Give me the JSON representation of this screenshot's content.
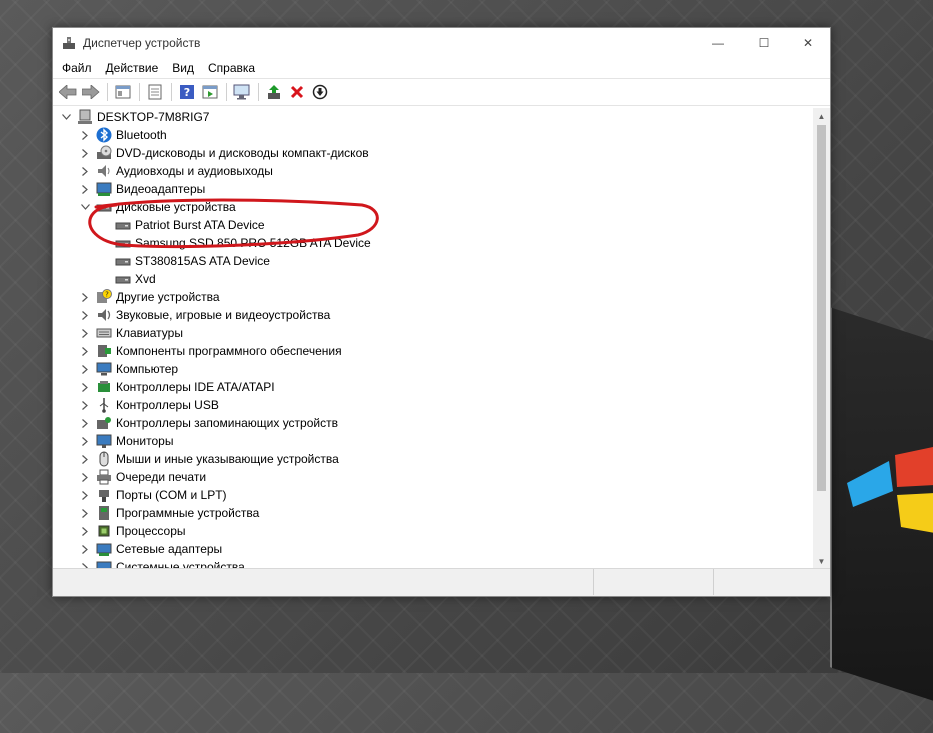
{
  "window": {
    "title": "Диспетчер устройств",
    "minimize_glyph": "—",
    "maximize_glyph": "☐",
    "close_glyph": "✕"
  },
  "menu": [
    "Файл",
    "Действие",
    "Вид",
    "Справка"
  ],
  "toolbar_icons": [
    "back-arrow-icon",
    "forward-arrow-icon",
    "properties-icon",
    "show-hidden-icon",
    "help-icon",
    "action-view-icon",
    "scan-hardware-icon",
    "update-driver-icon",
    "uninstall-icon",
    "disable-device-icon"
  ],
  "tree": {
    "root": "DESKTOP-7M8RIG7",
    "categories": [
      {
        "label": "Bluetooth",
        "icon": "bluetooth-icon",
        "expanded": false
      },
      {
        "label": "DVD-дисководы и дисководы компакт-дисков",
        "icon": "dvd-drive-icon",
        "expanded": false
      },
      {
        "label": "Аудиовходы и аудиовыходы",
        "icon": "audio-io-icon",
        "expanded": false
      },
      {
        "label": "Видеоадаптеры",
        "icon": "display-adapter-icon",
        "expanded": false
      },
      {
        "label": "Дисковые устройства",
        "icon": "disk-drive-icon",
        "expanded": true,
        "children": [
          "Patriot Burst ATA Device",
          "Samsung SSD 850 PRO 512GB ATA Device",
          "ST380815AS ATA Device",
          "Xvd"
        ]
      },
      {
        "label": "Другие устройства",
        "icon": "unknown-device-icon",
        "expanded": false
      },
      {
        "label": "Звуковые, игровые и видеоустройства",
        "icon": "speaker-icon",
        "expanded": false
      },
      {
        "label": "Клавиатуры",
        "icon": "keyboard-icon",
        "expanded": false
      },
      {
        "label": "Компоненты программного обеспечения",
        "icon": "software-component-icon",
        "expanded": false
      },
      {
        "label": "Компьютер",
        "icon": "computer-icon",
        "expanded": false
      },
      {
        "label": "Контроллеры IDE ATA/ATAPI",
        "icon": "ide-controller-icon",
        "expanded": false
      },
      {
        "label": "Контроллеры USB",
        "icon": "usb-icon",
        "expanded": false
      },
      {
        "label": "Контроллеры запоминающих устройств",
        "icon": "storage-controller-icon",
        "expanded": false
      },
      {
        "label": "Мониторы",
        "icon": "monitor-icon",
        "expanded": false
      },
      {
        "label": "Мыши и иные указывающие устройства",
        "icon": "mouse-icon",
        "expanded": false
      },
      {
        "label": "Очереди печати",
        "icon": "printer-icon",
        "expanded": false
      },
      {
        "label": "Порты (COM и LPT)",
        "icon": "port-icon",
        "expanded": false
      },
      {
        "label": "Программные устройства",
        "icon": "software-device-icon",
        "expanded": false
      },
      {
        "label": "Процессоры",
        "icon": "processor-icon",
        "expanded": false
      },
      {
        "label": "Сетевые адаптеры",
        "icon": "network-adapter-icon",
        "expanded": false
      },
      {
        "label": "Системные устройства",
        "icon": "system-device-icon",
        "expanded": false
      }
    ]
  },
  "colors": {
    "annotation": "#d0171c",
    "bluetooth": "#1d6fd1",
    "uninstall": "#d8141c"
  },
  "scrollbar": {
    "up_glyph": "▲",
    "down_glyph": "▼"
  }
}
